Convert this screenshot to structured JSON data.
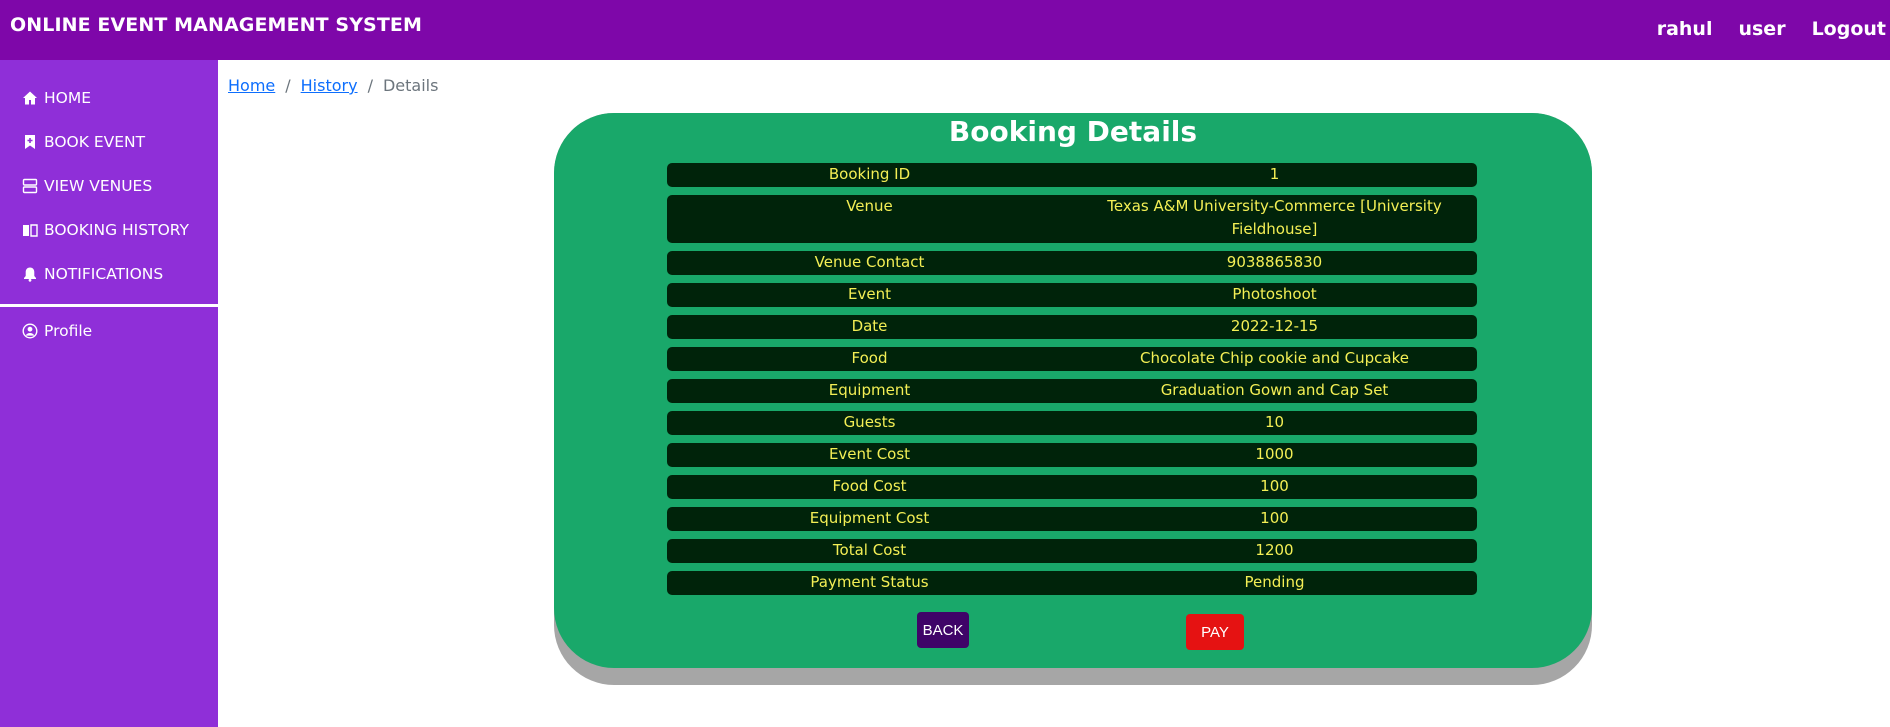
{
  "header": {
    "brand": "ONLINE EVENT MANAGEMENT SYSTEM",
    "nav": [
      "rahul",
      "user",
      "Logout"
    ]
  },
  "sidebar": {
    "items": [
      {
        "label": "HOME",
        "icon": "home-icon"
      },
      {
        "label": "BOOK EVENT",
        "icon": "bookmark-icon"
      },
      {
        "label": "VIEW VENUES",
        "icon": "server-icon"
      },
      {
        "label": "BOOKING HISTORY",
        "icon": "book-icon"
      },
      {
        "label": "NOTIFICATIONS",
        "icon": "bell-icon"
      }
    ],
    "profile": {
      "label": "Profile",
      "icon": "user-circle-icon"
    }
  },
  "breadcrumb": {
    "home": "Home",
    "history": "History",
    "current": "Details",
    "separator": "/"
  },
  "card": {
    "title": "Booking Details",
    "rows": [
      {
        "key": "Booking ID",
        "value": "1"
      },
      {
        "key": "Venue",
        "value": "Texas A&M University-Commerce [University Fieldhouse]"
      },
      {
        "key": "Venue Contact",
        "value": "9038865830"
      },
      {
        "key": "Event",
        "value": "Photoshoot"
      },
      {
        "key": "Date",
        "value": "2022-12-15"
      },
      {
        "key": "Food",
        "value": "Chocolate Chip cookie and Cupcake"
      },
      {
        "key": "Equipment",
        "value": "Graduation Gown and Cap Set"
      },
      {
        "key": "Guests",
        "value": "10"
      },
      {
        "key": "Event Cost",
        "value": "1000"
      },
      {
        "key": "Food Cost",
        "value": "100"
      },
      {
        "key": "Equipment Cost",
        "value": "100"
      },
      {
        "key": "Total Cost",
        "value": "1200"
      },
      {
        "key": "Payment Status",
        "value": "Pending"
      }
    ],
    "back_label": "BACK",
    "pay_label": "PAY"
  },
  "colors": {
    "header_bg": "#7e07a9",
    "sidebar_bg": "#8f2fd8",
    "card_bg": "#19a86a",
    "row_bg": "#00230a",
    "row_text": "#f3ef55",
    "back_bg": "#3f0468",
    "pay_bg": "#e51212"
  }
}
